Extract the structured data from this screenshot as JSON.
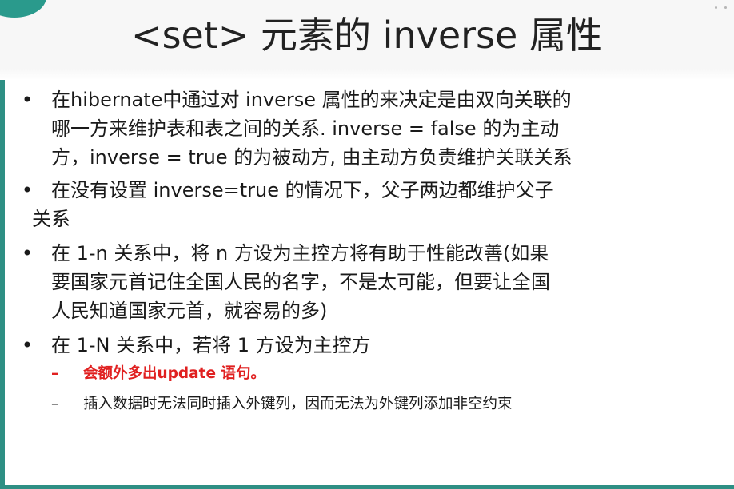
{
  "slide": {
    "title": "<set> 元素的 inverse 属性",
    "bullet_glyph": "•",
    "dash_glyph": "–",
    "bullets": [
      {
        "lines": [
          "在hibernate中通过对 inverse 属性的来决定是由双向关联的",
          "哪一方来维护表和表之间的关系. inverse = false 的为主动",
          "方，inverse = true 的为被动方, 由主动方负责维护关联关系"
        ]
      },
      {
        "lines": [
          "在没有设置 inverse=true 的情况下，父子两边都维护父子",
          "关系"
        ]
      },
      {
        "lines": [
          "在 1-n 关系中，将 n 方设为主控方将有助于性能改善(如果",
          "要国家元首记住全国人民的名字，不是太可能，但要让全国",
          "人民知道国家元首，就容易的多)"
        ]
      },
      {
        "lines": [
          "在 1-N 关系中，若将 1 方设为主控方"
        ],
        "subs": [
          "会额外多出update 语句。",
          "插入数据时无法同时插入外键列，因而无法为外键列添加非空约束"
        ]
      }
    ]
  },
  "colors": {
    "accent_teal": "#2e8f84",
    "highlight_red": "#e02020",
    "text": "#1a1a1a"
  }
}
